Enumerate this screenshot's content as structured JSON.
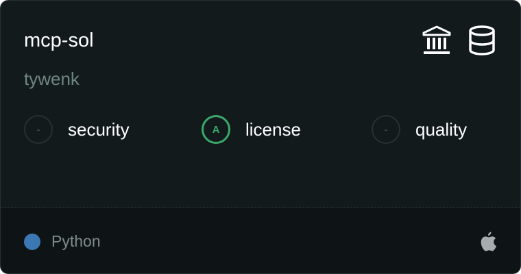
{
  "card": {
    "title": "mcp-sol",
    "owner": "tywenk",
    "header_icons": [
      "bank-icon",
      "database-icon"
    ],
    "scores": [
      {
        "badge": "-",
        "label": "security",
        "state": "unrated"
      },
      {
        "badge": "A",
        "label": "license",
        "state": "graded"
      },
      {
        "badge": "-",
        "label": "quality",
        "state": "unrated"
      }
    ],
    "footer": {
      "language": "Python",
      "language_color": "#3b78b3",
      "platform_icon": "apple-icon"
    }
  },
  "colors": {
    "card_background": "#121a1c",
    "footer_background": "#0e1416",
    "owner_text": "#6f8784",
    "grade_a": "#3aa86c"
  }
}
